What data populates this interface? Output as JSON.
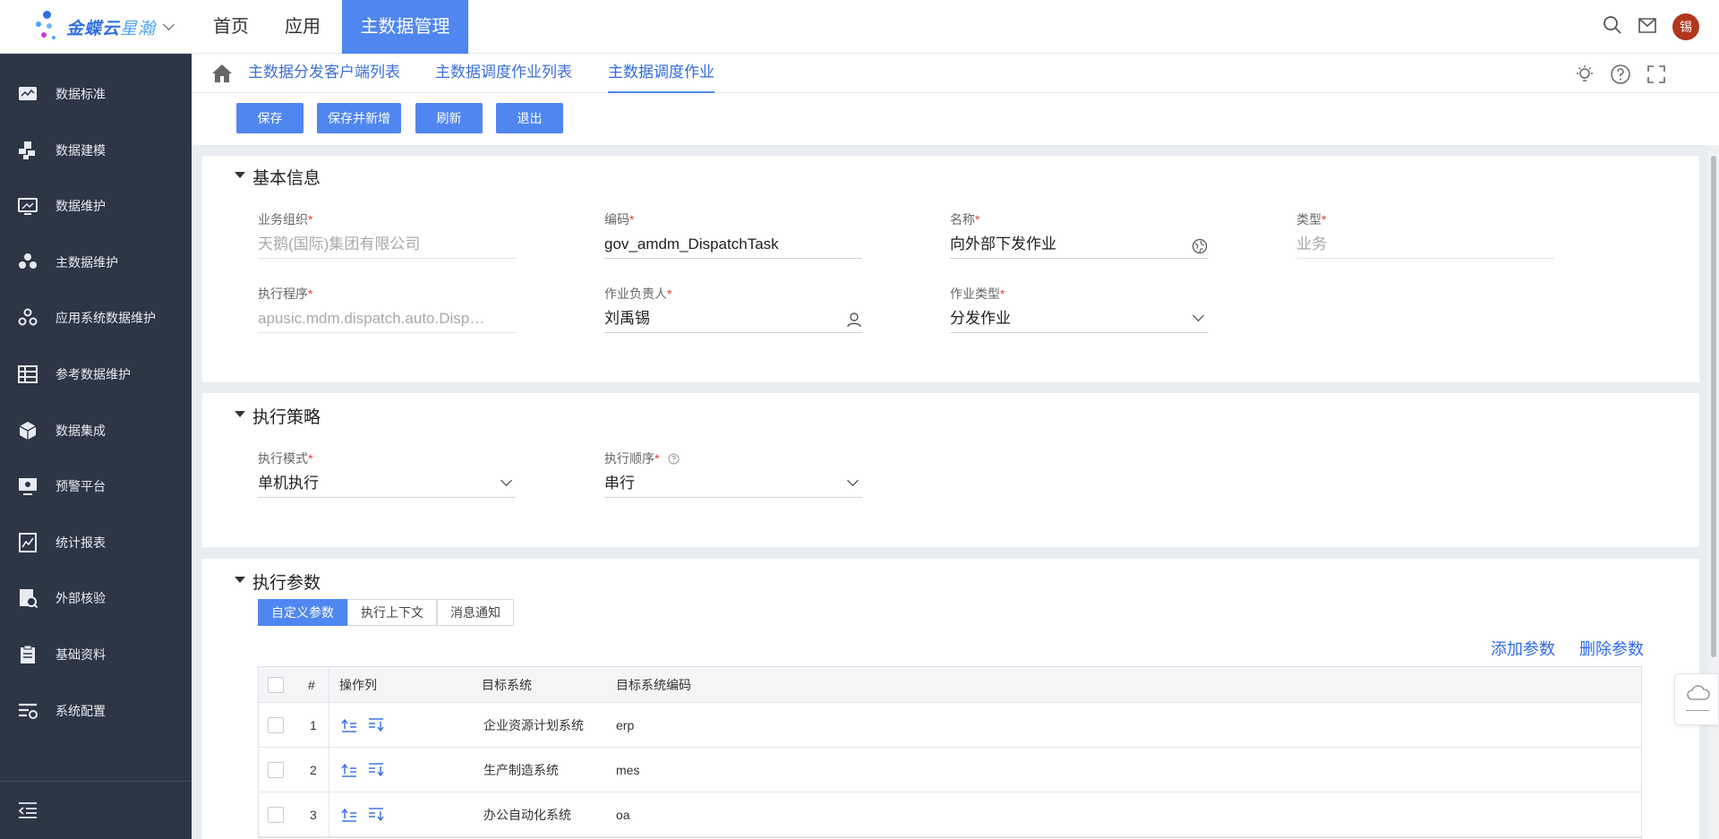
{
  "brand": {
    "name": "金蝶云",
    "sub": "星瀚"
  },
  "topnav": [
    "首页",
    "应用",
    "主数据管理"
  ],
  "user": {
    "avatar_text": "锡"
  },
  "sidebar": {
    "items": [
      {
        "label": "数据标准",
        "icon": "chart-monitor-icon"
      },
      {
        "label": "数据建模",
        "icon": "blocks-icon"
      },
      {
        "label": "数据维护",
        "icon": "monitor-icon"
      },
      {
        "label": "主数据维护",
        "icon": "people-icon"
      },
      {
        "label": "应用系统数据维护",
        "icon": "gears-icon"
      },
      {
        "label": "参考数据维护",
        "icon": "table-icon"
      },
      {
        "label": "数据集成",
        "icon": "cube-icon"
      },
      {
        "label": "预警平台",
        "icon": "alert-screen-icon"
      },
      {
        "label": "统计报表",
        "icon": "report-icon"
      },
      {
        "label": "外部核验",
        "icon": "verify-icon"
      },
      {
        "label": "基础资料",
        "icon": "clipboard-icon"
      },
      {
        "label": "系统配置",
        "icon": "settings-list-icon"
      }
    ]
  },
  "tabs": [
    "主数据分发客户端列表",
    "主数据调度作业列表",
    "主数据调度作业"
  ],
  "toolbar": {
    "save": "保存",
    "save_new": "保存并新增",
    "refresh": "刷新",
    "exit": "退出"
  },
  "basic": {
    "title": "基本信息",
    "org_label": "业务组织",
    "org_value": "天鹅(国际)集团有限公司",
    "code_label": "编码",
    "code_value": "gov_amdm_DispatchTask",
    "name_label": "名称",
    "name_value": "向外部下发作业",
    "type_label": "类型",
    "type_value": "业务",
    "program_label": "执行程序",
    "program_value": "apusic.mdm.dispatch.auto.DispatchTask",
    "owner_label": "作业负责人",
    "owner_value": "刘禹锡",
    "jobtype_label": "作业类型",
    "jobtype_value": "分发作业"
  },
  "strategy": {
    "title": "执行策略",
    "mode_label": "执行模式",
    "mode_value": "单机执行",
    "order_label": "执行顺序",
    "order_value": "串行"
  },
  "params": {
    "title": "执行参数",
    "tabs": [
      "自定义参数",
      "执行上下文",
      "消息通知"
    ],
    "add": "添加参数",
    "delete": "删除参数",
    "columns": [
      "#",
      "操作列",
      "目标系统",
      "目标系统编码"
    ],
    "rows": [
      {
        "no": "1",
        "system": "企业资源计划系统",
        "code": "erp"
      },
      {
        "no": "2",
        "system": "生产制造系统",
        "code": "mes"
      },
      {
        "no": "3",
        "system": "办公自动化系统",
        "code": "oa"
      }
    ]
  }
}
